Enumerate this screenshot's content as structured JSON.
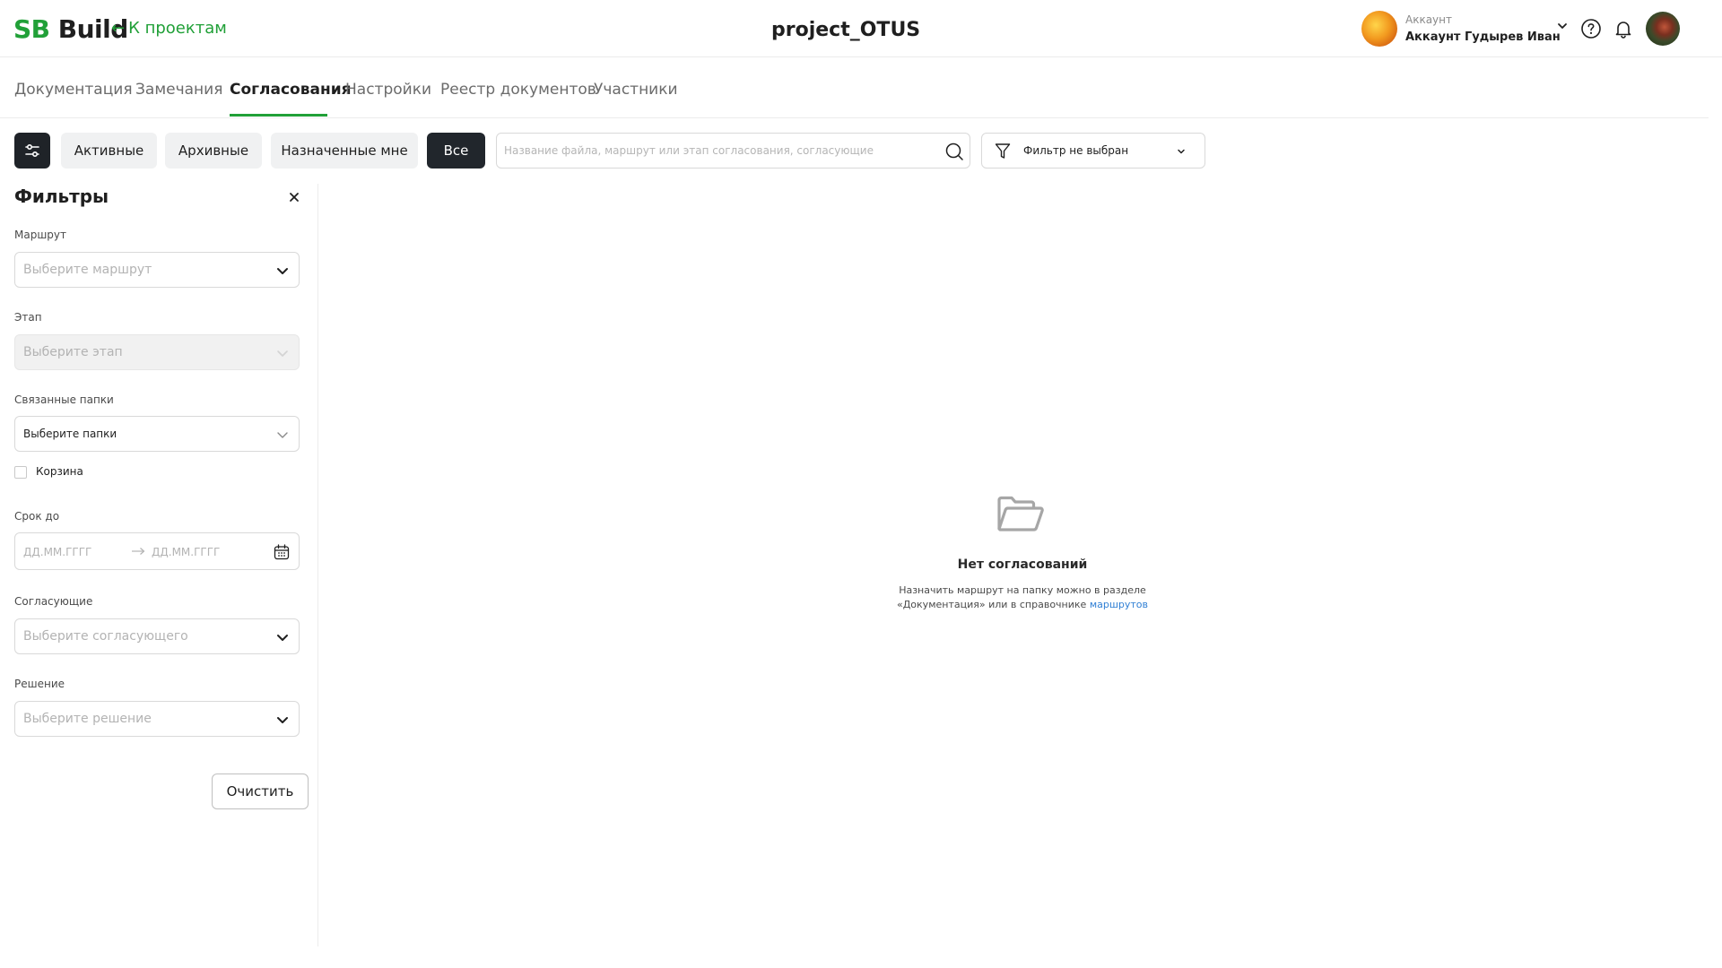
{
  "header": {
    "logo_sb": "SB",
    "logo_build": "Build",
    "back_label": "К проектам",
    "project_title": "project_OTUS",
    "account_label": "Аккаунт",
    "account_name": "Аккаунт Гудырев Иван"
  },
  "tabs": [
    {
      "label": "Документация",
      "active": false
    },
    {
      "label": "Замечания",
      "active": false
    },
    {
      "label": "Согласования",
      "active": true
    },
    {
      "label": "Настройки",
      "active": false
    },
    {
      "label": "Реестр документов",
      "active": false
    },
    {
      "label": "Участники",
      "active": false
    }
  ],
  "toolbar": {
    "chips": [
      {
        "label": "Активные",
        "selected": false
      },
      {
        "label": "Архивные",
        "selected": false
      },
      {
        "label": "Назначенные мне",
        "selected": false
      },
      {
        "label": "Все",
        "selected": true
      }
    ],
    "search_placeholder": "Название файла, маршрут или этап согласования, согласующие",
    "filter_value": "Фильтр не выбран"
  },
  "filters": {
    "title": "Фильтры",
    "route": {
      "label": "Маршрут",
      "placeholder": "Выберите маршрут"
    },
    "stage": {
      "label": "Этап",
      "placeholder": "Выберите этап",
      "disabled": true
    },
    "folders": {
      "label": "Связанные папки",
      "value": "Выберите папки"
    },
    "trash": {
      "label": "Корзина",
      "checked": false
    },
    "deadline": {
      "label": "Срок до",
      "from_placeholder": "ДД.ММ.ГГГГ",
      "to_placeholder": "ДД.ММ.ГГГГ"
    },
    "approvers": {
      "label": "Согласующие",
      "placeholder": "Выберите согласующего"
    },
    "decision": {
      "label": "Решение",
      "placeholder": "Выберите решение"
    },
    "clear_label": "Очистить"
  },
  "empty_state": {
    "title": "Нет согласований",
    "text_line1": "Назначить маршрут на папку можно в разделе",
    "text_line2": "«Документация» или в справочнике ",
    "link": "маршрутов"
  },
  "colors": {
    "brand_green": "#21a038",
    "dark_button": "#21262c",
    "link_blue": "#2f7fd4"
  }
}
